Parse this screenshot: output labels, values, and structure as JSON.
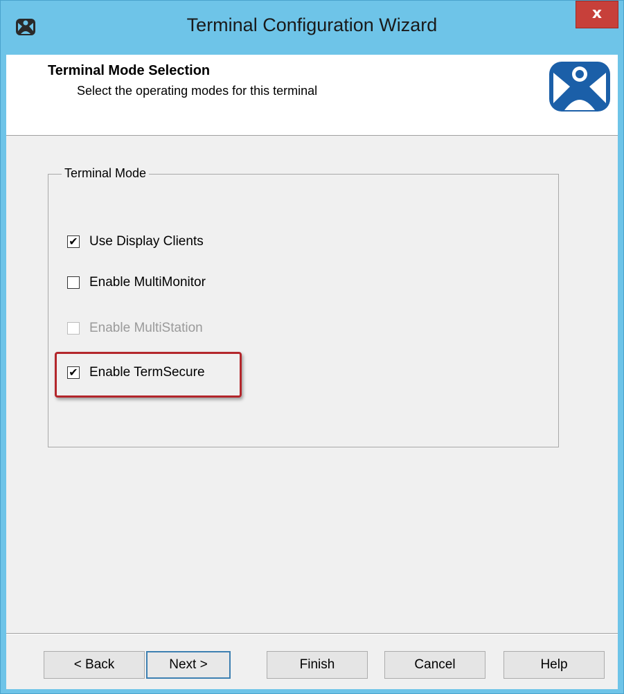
{
  "window": {
    "title": "Terminal Configuration Wizard",
    "close_glyph": "x",
    "icon": "thinmanager-logo-icon"
  },
  "header": {
    "title": "Terminal Mode Selection",
    "subtitle": "Select the operating modes for this terminal",
    "logo": "thinmanager-logo-icon"
  },
  "group": {
    "legend": "Terminal Mode",
    "options": [
      {
        "label": "Use Display Clients",
        "checked": true,
        "enabled": true
      },
      {
        "label": "Enable MultiMonitor",
        "checked": false,
        "enabled": true
      },
      {
        "label": "Enable MultiStation",
        "checked": false,
        "enabled": false
      },
      {
        "label": "Enable TermSecure",
        "checked": true,
        "enabled": true,
        "highlighted": true
      }
    ]
  },
  "buttons": {
    "back": "< Back",
    "next": "Next >",
    "finish": "Finish",
    "cancel": "Cancel",
    "help": "Help"
  },
  "colors": {
    "title_bar": "#6ec4e8",
    "close_button": "#c7403a",
    "highlight": "#b3262b",
    "logo_blue": "#1b5fa8"
  }
}
